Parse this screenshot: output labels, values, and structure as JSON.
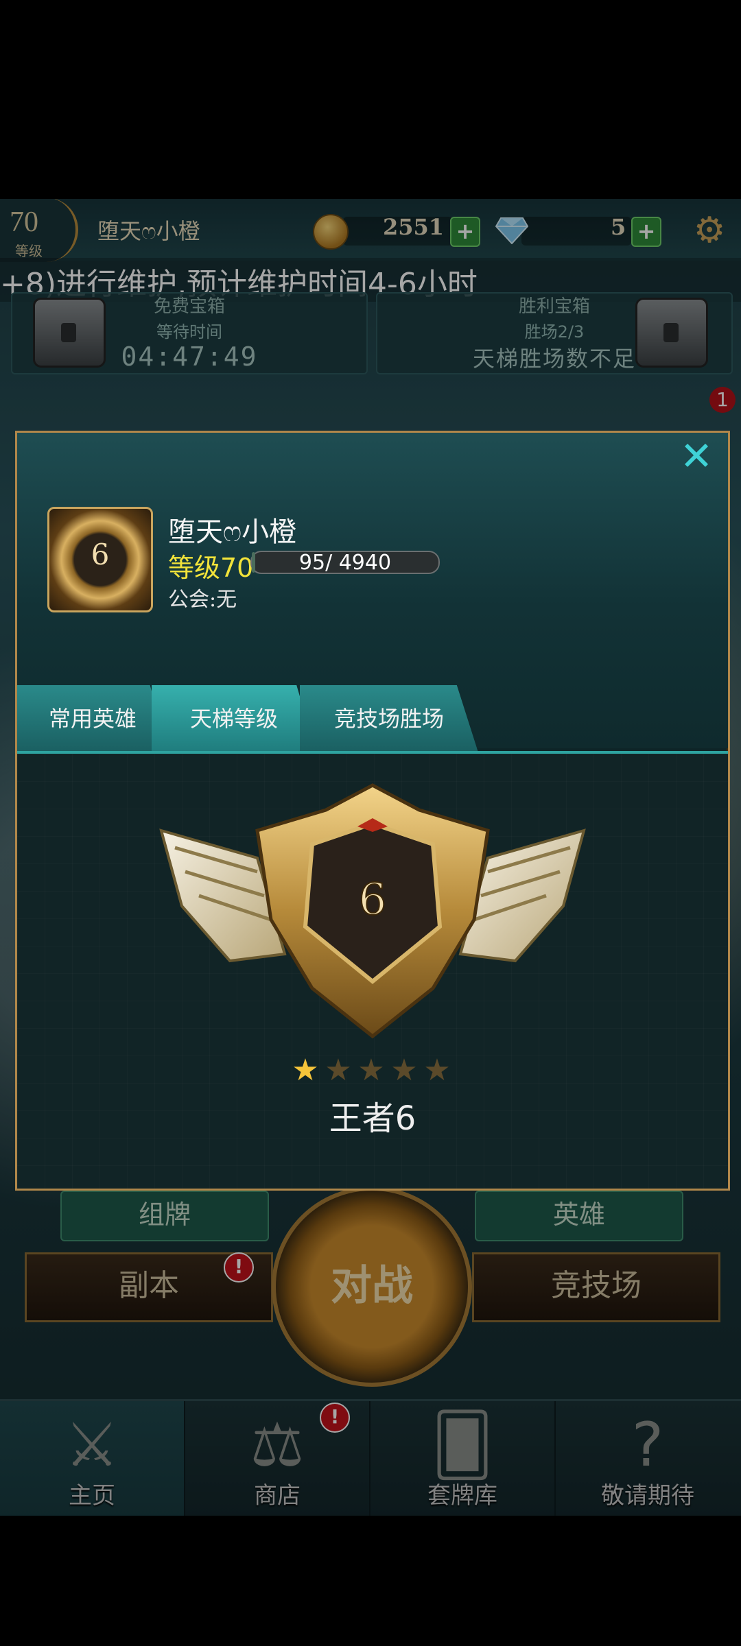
{
  "top_bar": {
    "level": "70",
    "level_caption": "等级",
    "player_name": "堕天ෆ小橙",
    "gold": "2551",
    "gems": "5",
    "plus": "+"
  },
  "marquee": "+8)进行维护,预计维护时间4-6小时",
  "chests": {
    "free": {
      "title": "免费宝箱",
      "sub": "等待时间",
      "value": "04:47:49"
    },
    "victory": {
      "title": "胜利宝箱",
      "sub": "胜场2/3",
      "value": "天梯胜场数不足"
    }
  },
  "notification_count": "1",
  "menu": {
    "deck": "组牌",
    "heroes": "英雄",
    "battle": "对战",
    "dungeon": "副本",
    "arena": "竞技场",
    "alert": "!"
  },
  "nav": [
    {
      "label": "主页",
      "icon": "crossed-swords-icon"
    },
    {
      "label": "商店",
      "icon": "scale-icon"
    },
    {
      "label": "套牌库",
      "icon": "cards-icon"
    },
    {
      "label": "敬请期待",
      "icon": "question-icon"
    }
  ],
  "profile": {
    "name": "堕天ෆ小橙",
    "level_text": "等级70",
    "xp_text": "95/ 4940",
    "xp_progress": 0.02,
    "guild_text": "公会:无",
    "avatar_rank": "6",
    "close": "✕",
    "tabs": [
      "常用英雄",
      "天梯等级",
      "竞技场胜场"
    ],
    "active_tab": 1,
    "emblem_rank": "6",
    "stars_filled": 1,
    "stars_total": 5,
    "rank_title": "王者6"
  },
  "colors": {
    "accent_gold": "#c9a55e",
    "level_yellow": "#f2e33a",
    "teal_tab": "#2ea3a0",
    "close_cyan": "#3fd2d6"
  }
}
